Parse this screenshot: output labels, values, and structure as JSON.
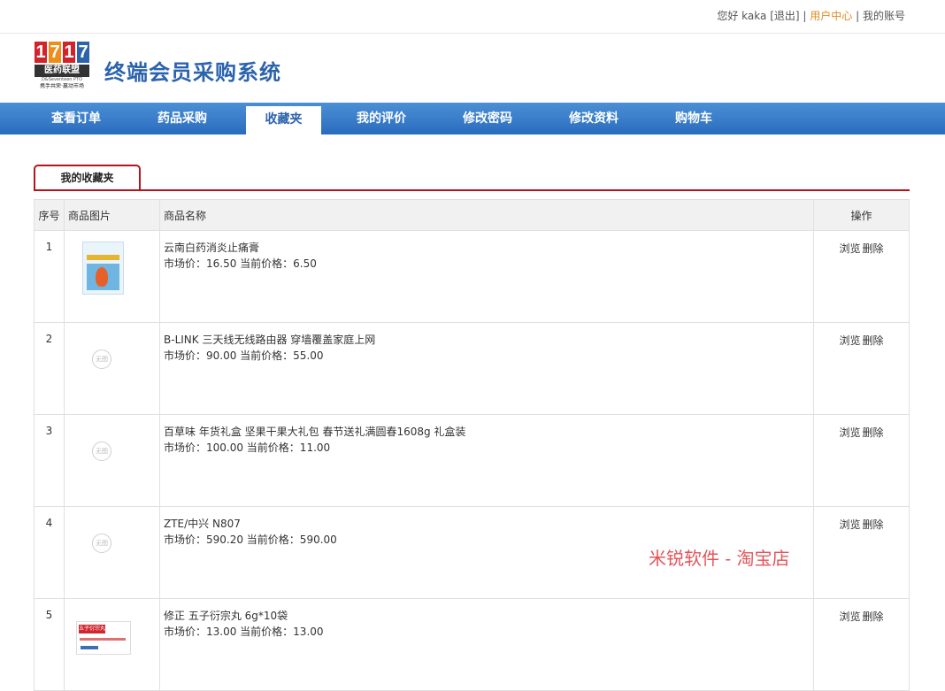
{
  "top_links": {
    "greeting": "您好 kaka",
    "logout": "[退出]",
    "sep": "|",
    "user_center": "用户中心",
    "my_account": "我的账号"
  },
  "logo": {
    "digits": [
      "1",
      "7",
      "1",
      "7"
    ],
    "brand": "医药联盟",
    "sub_en": "D&Seventeen PTO",
    "slogan": "携手共荣·赢动市场"
  },
  "site_title": "终端会员采购系统",
  "nav": [
    {
      "label": "查看订单"
    },
    {
      "label": "药品采购"
    },
    {
      "label": "收藏夹",
      "active": true
    },
    {
      "label": "我的评价"
    },
    {
      "label": "修改密码"
    },
    {
      "label": "修改资料"
    },
    {
      "label": "购物车"
    }
  ],
  "section_tab": "我的收藏夹",
  "table": {
    "headers": [
      "序号",
      "商品图片",
      "商品名称",
      "操作"
    ],
    "rows": [
      {
        "index": "1",
        "name": "云南白药消炎止痛膏",
        "price": "市场价：16.50 当前价格：6.50",
        "image": "product-photo"
      },
      {
        "index": "2",
        "name": "B-LINK 三天线无线路由器 穿墙覆盖家庭上网",
        "price": "市场价：90.00 当前价格：55.00",
        "image": "no-image"
      },
      {
        "index": "3",
        "name": "百草味 年货礼盒 坚果干果大礼包 春节送礼满圆春1608g 礼盒装",
        "price": "市场价：100.00 当前价格：11.00",
        "image": "no-image"
      },
      {
        "index": "4",
        "name": "ZTE/中兴 N807",
        "price": "市场价：590.20 当前价格：590.00",
        "image": "no-image"
      },
      {
        "index": "5",
        "name": "修正 五子衍宗丸 6g*10袋",
        "price": "市场价：13.00 当前价格：13.00",
        "image": "product-photo"
      }
    ],
    "browse_label": "浏览",
    "delete_label": "删除",
    "no_image_text": "无图",
    "thumb5_text": "五子衍宗丸"
  },
  "watermark": "米锐软件 - 淘宝店",
  "colors": {
    "nav_blue": "#2a6cbd",
    "accent_red": "#b4141c",
    "title_blue": "#2b63ad",
    "user_center_orange": "#e08a1e"
  }
}
